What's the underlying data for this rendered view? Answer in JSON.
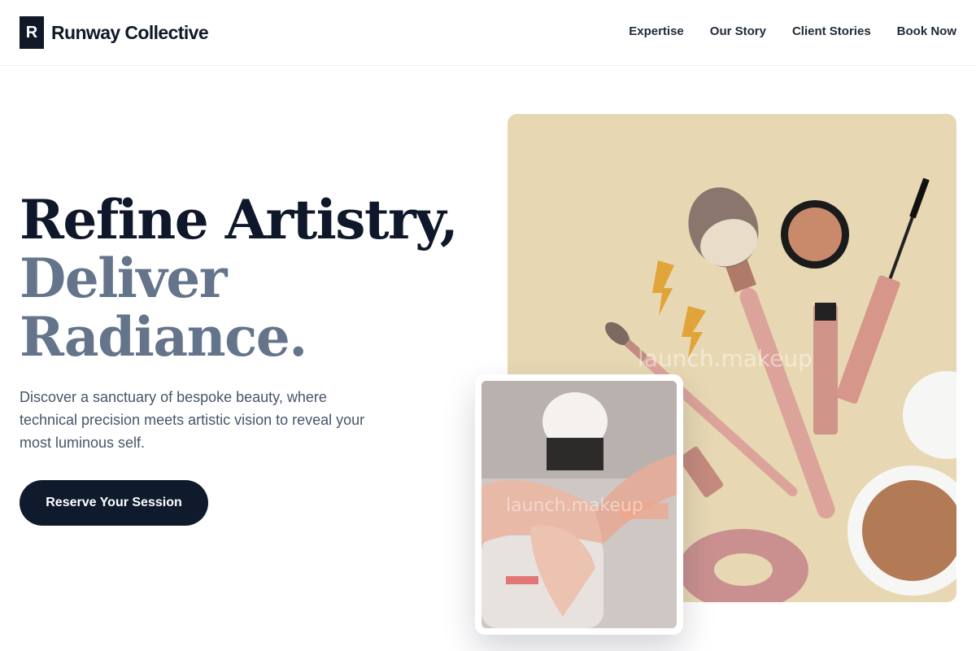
{
  "brand": {
    "mark": "R",
    "name": "Runway Collective"
  },
  "nav": [
    {
      "label": "Expertise"
    },
    {
      "label": "Our Story"
    },
    {
      "label": "Client Stories"
    },
    {
      "label": "Book Now"
    }
  ],
  "hero": {
    "headline_line1": "Refine Artistry,",
    "headline_line2": "Deliver",
    "headline_line3": "Radiance.",
    "subcopy": "Discover a sanctuary of bespoke beauty, where technical precision meets artistic vision to reveal your most luminous self.",
    "cta_label": "Reserve Your Session"
  },
  "images": {
    "main_alt": "Flat lay of makeup brushes, mascara, lipstick, compact powder and gold earrings",
    "main_watermark": "launch.makeup",
    "inset_alt": "Nail technician applying polish to a client's nails",
    "inset_watermark": "launch.makeup"
  },
  "colors": {
    "primary": "#0f172a",
    "muted": "#64748b",
    "cta": "#0f1b2d",
    "beige": "#e7d8b3"
  }
}
